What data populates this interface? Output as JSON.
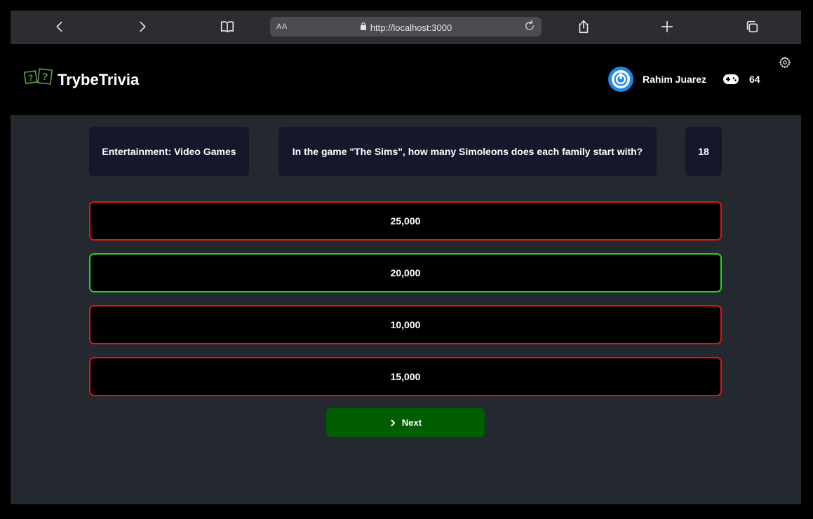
{
  "browser": {
    "url_prefix": "AA",
    "url": "http://localhost:3000",
    "icons": [
      "back-icon",
      "forward-icon",
      "bookmarks-icon",
      "lock-icon",
      "reload-icon",
      "share-icon",
      "new-tab-icon",
      "tabs-icon"
    ]
  },
  "header": {
    "app_title": "TrybeTrivia",
    "player_name": "Rahim Juarez",
    "score": "64",
    "icons": [
      "logo-icon",
      "avatar",
      "gamepad-icon",
      "gear-icon"
    ]
  },
  "question": {
    "category": "Entertainment: Video Games",
    "text": "In the game \"The Sims\", how many Simoleons does each family start with?",
    "timer": "18"
  },
  "answers": [
    {
      "label": "25,000",
      "status": "wrong"
    },
    {
      "label": "20,000",
      "status": "correct"
    },
    {
      "label": "10,000",
      "status": "wrong"
    },
    {
      "label": "15,000",
      "status": "wrong"
    }
  ],
  "next_button": {
    "label": "Next"
  },
  "colors": {
    "correct_border": "#22d422",
    "wrong_border": "#e0141b",
    "next_button_bg": "#005e00",
    "card_bg": "#15172a",
    "page_bg": "#24282f"
  }
}
